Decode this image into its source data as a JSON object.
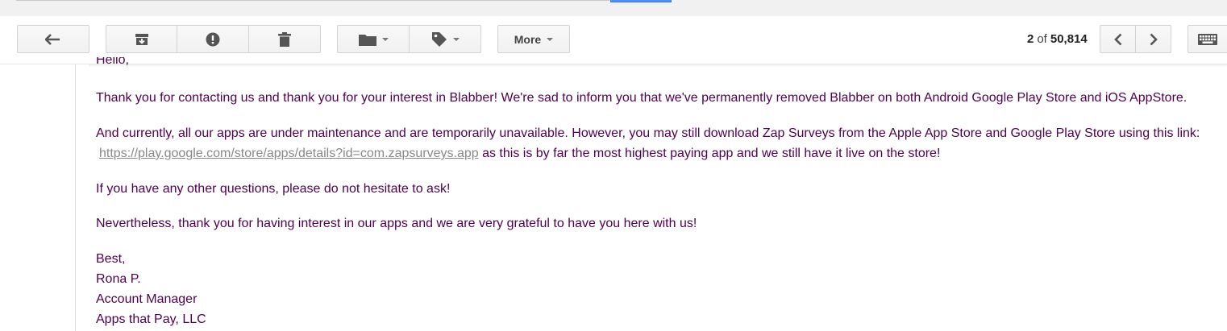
{
  "toolbar": {
    "more_label": "More",
    "pager": {
      "current": "2",
      "of_label": "of",
      "total": "50,814"
    }
  },
  "icons": {
    "back": "reply-back-icon",
    "archive": "archive-icon",
    "spam": "report-spam-icon",
    "delete": "trash-icon",
    "move": "folder-icon",
    "labels": "label-tag-icon",
    "prev": "chevron-left-icon",
    "next": "chevron-right-icon",
    "keyboard": "keyboard-icon"
  },
  "message": {
    "greeting": "Hello,",
    "para1": "Thank you for contacting us and thank you for your interest in Blabber! We're sad to inform you that we've permanently removed Blabber on both Android Google Play Store and iOS AppStore.",
    "para2_text": "And currently, all our apps are under maintenance and are temporarily unavailable. However, you may still download Zap Surveys from the Apple App Store and Google Play Store using this link: ",
    "para2_link": "https://play.google.com/store/apps/details?id=com.zapsurveys.app",
    "para2_tail": " as this is by far the most highest paying app and we still have it live on the store!",
    "para3": "If you have any other questions, please do not hesitate to ask!",
    "para4": "Nevertheless, thank you for having interest in our apps and we are very grateful to have you here with us!",
    "signoff": "Best,",
    "sender_name": "Rona P.",
    "sender_title": "Account Manager",
    "sender_company": "Apps that Pay, LLC"
  },
  "colors": {
    "text": "#500050",
    "link": "#888888",
    "button_bg": "#f5f5f5",
    "button_border": "#d3d3d3"
  }
}
